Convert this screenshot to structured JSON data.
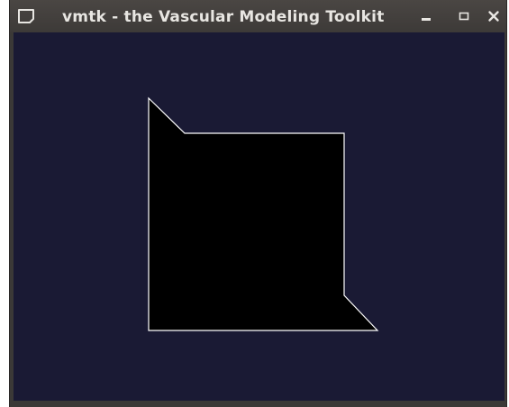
{
  "window": {
    "title": "vmtk - the Vascular Modeling Toolkit",
    "controls": {
      "minimize_icon": "minimize-icon",
      "maximize_icon": "maximize-icon",
      "close_icon": "close-icon"
    },
    "app_icon": "window-menu-icon"
  },
  "viewport": {
    "background_color": "#1a1a34",
    "shape_fill_color": "#000000",
    "shape_outline_color": "#ffffff"
  }
}
